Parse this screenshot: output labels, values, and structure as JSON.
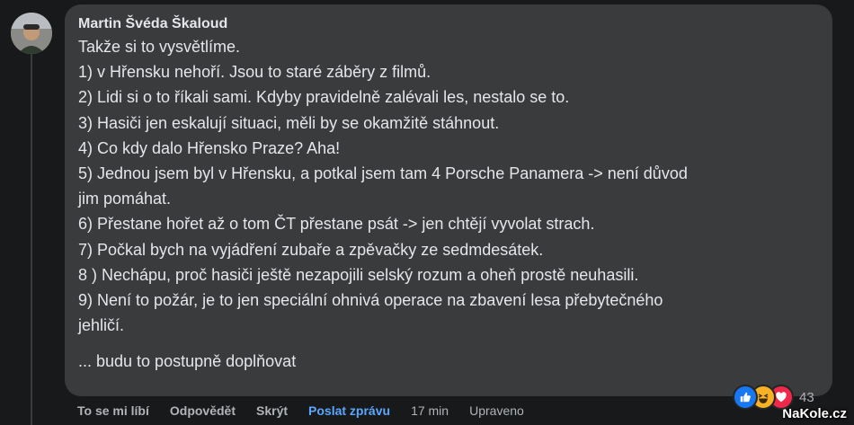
{
  "comment": {
    "author": "Martin Švéda Škaloud",
    "lines": [
      "Takže si to vysvětlíme.",
      "1) v Hřensku nehoří. Jsou to staré záběry z filmů.",
      "2) Lidi si o to říkali sami. Kdyby pravidelně zalévali les, nestalo se to.",
      "3) Hasiči jen eskalují situaci, měli by se okamžitě stáhnout.",
      "4) Co kdy dalo Hřensko Praze? Aha!",
      "5) Jednou jsem byl v Hřensku, a potkal jsem tam 4 Porsche Panamera -> není důvod",
      "jim pomáhat.",
      "6) Přestane hořet až o tom ČT přestane psát -> jen chtějí vyvolat strach.",
      "7) Počkal bych na vyjádření zubaře a zpěvačky ze sedmdesátek.",
      "8 ) Nechápu, proč hasiči ještě nezapojili selský rozum a oheň prostě neuhasili.",
      "9) Není to požár, je to jen speciální ohnivá operace na zbavení lesa přebytečného",
      "jehličí."
    ],
    "footer_line": "... budu to postupně doplňovat"
  },
  "actions": {
    "like": "To se mi líbí",
    "reply": "Odpovědět",
    "hide": "Skrýt",
    "message": "Poslat zprávu",
    "time": "17 min",
    "edited": "Upraveno"
  },
  "reactions": {
    "icons": [
      "like-icon",
      "haha-icon",
      "love-icon"
    ],
    "count": "43"
  },
  "watermark": "NaKole.cz",
  "colors": {
    "background": "#18191a",
    "bubble": "#3a3b3c",
    "text": "#e4e6eb",
    "secondary": "#b0b3b8",
    "link": "#5aa7ff"
  }
}
